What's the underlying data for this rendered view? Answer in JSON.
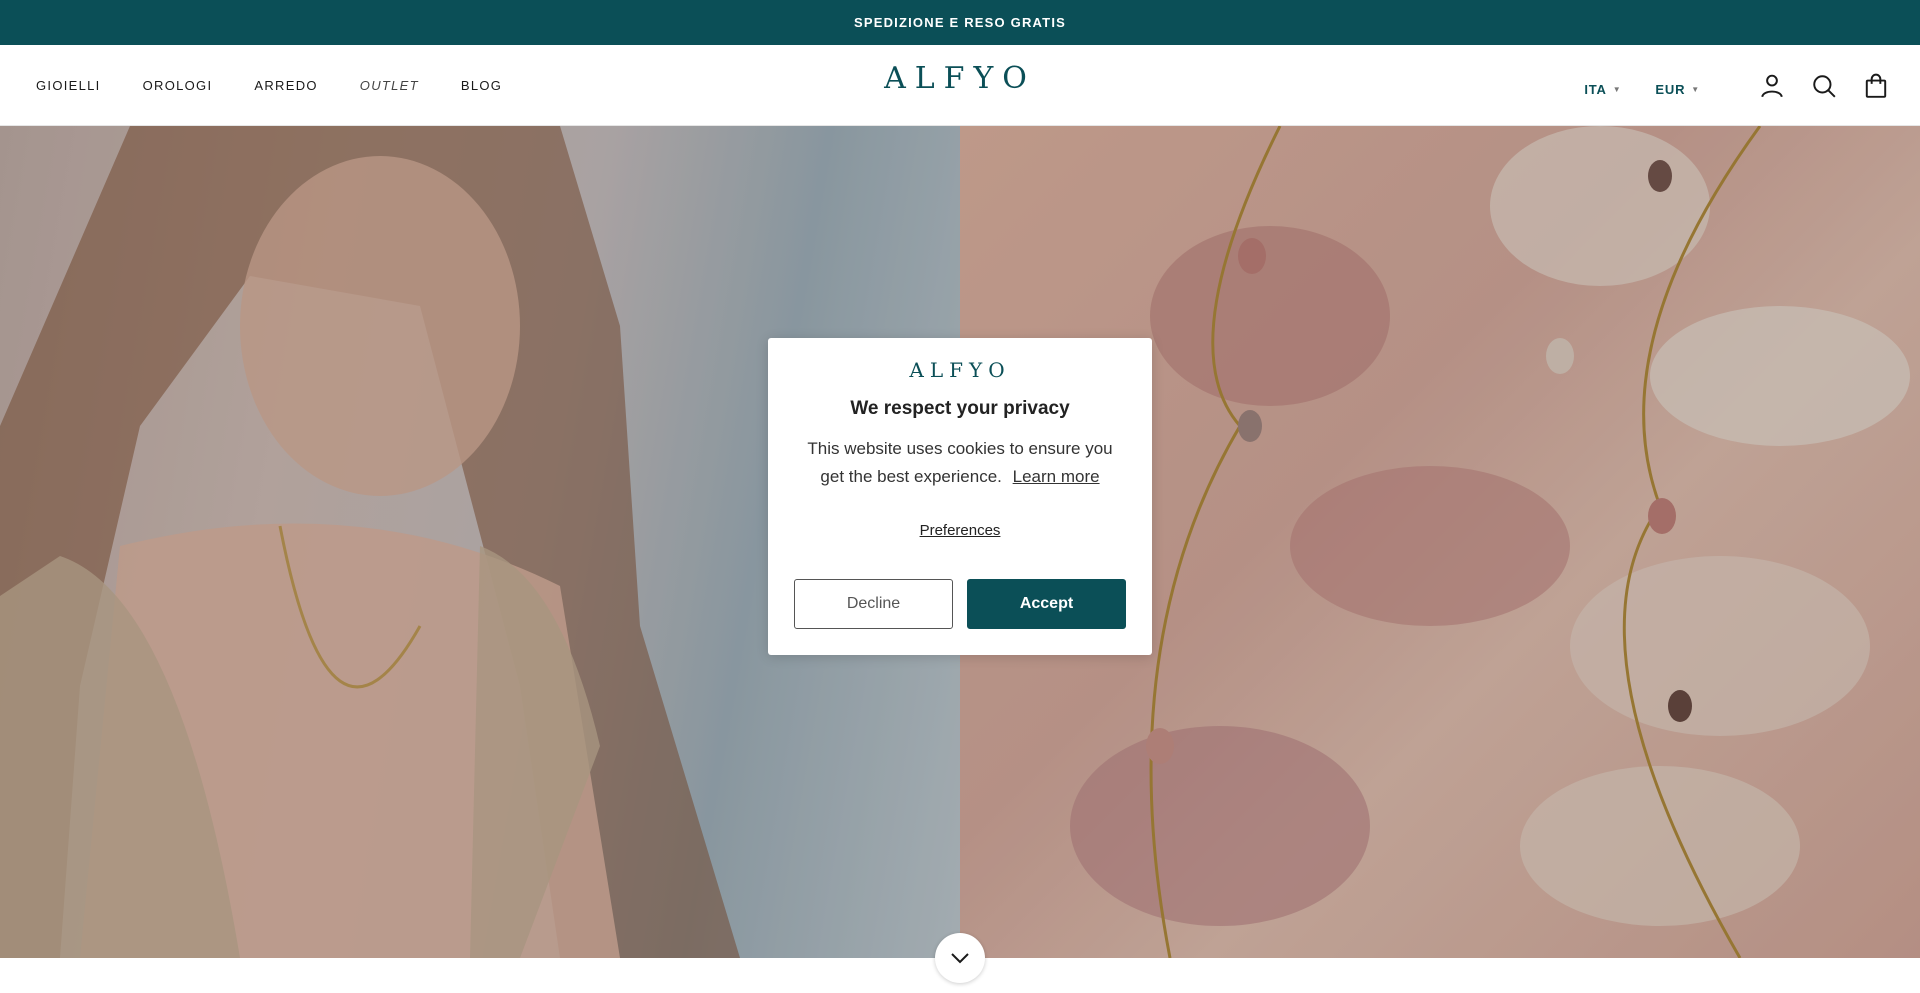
{
  "announcement": {
    "text": "SPEDIZIONE E RESO GRATIS"
  },
  "header": {
    "nav": [
      {
        "label": "GIOIELLI"
      },
      {
        "label": "OROLOGI"
      },
      {
        "label": "ARREDO"
      },
      {
        "label": "OUTLET"
      },
      {
        "label": "BLOG"
      }
    ],
    "logo": "ALFYO",
    "language": "ITA",
    "currency": "EUR",
    "icons": [
      "account-icon",
      "search-icon",
      "cart-icon"
    ]
  },
  "hero": {
    "left_image": "woman-wearing-necklace-photo",
    "right_image": "necklace-on-pink-paint-photo"
  },
  "cookie_modal": {
    "logo": "ALFYO",
    "title": "We respect your privacy",
    "body": "This website uses cookies to ensure you get the best experience.",
    "learn_more": "Learn more",
    "preferences": "Preferences",
    "decline": "Decline",
    "accept": "Accept"
  },
  "colors": {
    "brand": "#0b4f57",
    "announcement_bg": "#0b4f57"
  }
}
